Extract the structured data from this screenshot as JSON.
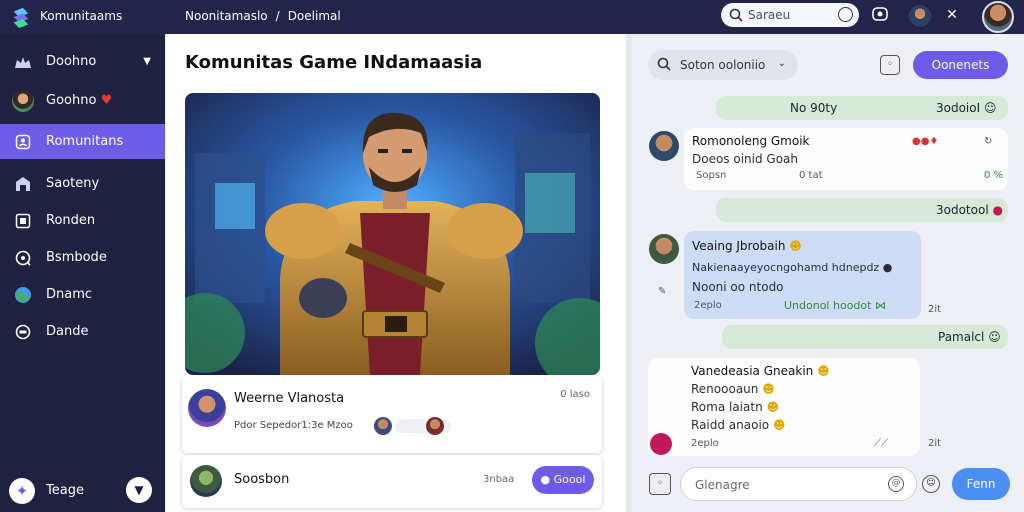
{
  "app": {
    "title": "Komunitaams"
  },
  "breadcrumb": {
    "items": [
      "Noonitamaslo",
      "Doelimal"
    ],
    "separator": "/"
  },
  "topbar": {
    "search_placeholder": "Saraeu"
  },
  "sidebar": {
    "items": [
      {
        "label": "Doohno",
        "icon": "dashboard-icon",
        "active": false,
        "has_chevron": true
      },
      {
        "label": "Goohno",
        "icon": "profile-avatar-icon",
        "active": false,
        "badge_icon": "heart-icon"
      },
      {
        "label": "Romunitans",
        "icon": "community-icon",
        "active": true
      },
      {
        "label": "Saoteny",
        "icon": "shop-icon",
        "active": false
      },
      {
        "label": "Ronden",
        "icon": "frame-icon",
        "active": false
      },
      {
        "label": "Bsmbode",
        "icon": "headset-icon",
        "active": false
      },
      {
        "label": "Dnamc",
        "icon": "globe-icon",
        "active": false
      },
      {
        "label": "Dande",
        "icon": "chat-icon",
        "active": false
      }
    ],
    "footer": {
      "label": "Teage"
    }
  },
  "main": {
    "title": "Komunitas Game INdamaasia",
    "post": {
      "author": "Weerne Vlanosta",
      "time": "0 laso",
      "meta": "Pdor  Sepedor1:3e Mzoo"
    },
    "user": {
      "name": "Soosbon",
      "subtitle": "3nbaa",
      "button": "Goool"
    }
  },
  "chat": {
    "filter_label": "Soton ooloniio",
    "primary_button": "Oonenets",
    "messages": [
      {
        "type": "out",
        "text": "No 90ty",
        "right": "3odoioI"
      },
      {
        "type": "in",
        "name": "Romonoleng Gmoik",
        "lines": [
          "Doeos oinid Goah"
        ],
        "meta_left": "Sopsn",
        "meta_mid": "0 tat",
        "meta_right": "0 %"
      },
      {
        "type": "out",
        "text": "",
        "right": "3odotool"
      },
      {
        "type": "in",
        "name": "Veaing Jbrobaih",
        "lines": [
          "Nakienaayeyocngohamd hdnepdz",
          "Nooni oo ntodo"
        ],
        "meta_left": "2eplo",
        "meta_right": "Undonol hoodot",
        "meta_far": "2it"
      },
      {
        "type": "out",
        "text": "Pamalcl",
        "right": ""
      },
      {
        "type": "in",
        "name": "Vanedeasia Gneakin",
        "lines": [
          "Renoooaun",
          "Roma laiatn",
          "Raidd anaoio"
        ],
        "meta_left": "2eplo",
        "meta_far": "2it"
      }
    ],
    "composer_placeholder": "Glenagre",
    "send_button": "Fenn"
  }
}
